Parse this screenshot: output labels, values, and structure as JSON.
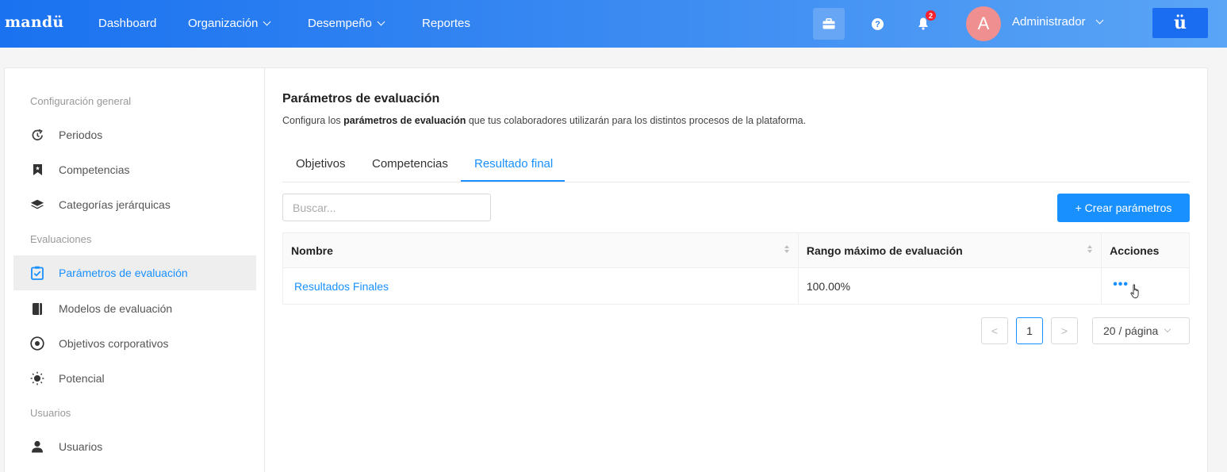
{
  "header": {
    "logo": "mandü",
    "nav": [
      {
        "label": "Dashboard",
        "dropdown": false
      },
      {
        "label": "Organización",
        "dropdown": true
      },
      {
        "label": "Desempeño",
        "dropdown": true
      },
      {
        "label": "Reportes",
        "dropdown": false
      }
    ],
    "help_glyph": "?",
    "notifications_count": "2",
    "avatar_initial": "A",
    "username": "Administrador",
    "brand_button": "ü",
    "colors": {
      "bar_start": "#1a72f0",
      "bar_end": "#5aa5f6",
      "avatar": "#ef8f8f"
    }
  },
  "sidebar": {
    "groups": [
      {
        "label": "Configuración general",
        "items": [
          {
            "label": "Periodos",
            "icon": "refresh-clock-icon"
          },
          {
            "label": "Competencias",
            "icon": "bookmark-icon"
          },
          {
            "label": "Categorías jerárquicas",
            "icon": "layers-icon"
          }
        ]
      },
      {
        "label": "Evaluaciones",
        "items": [
          {
            "label": "Parámetros de evaluación",
            "icon": "checklist-icon",
            "active": true
          },
          {
            "label": "Modelos de evaluación",
            "icon": "book-icon"
          },
          {
            "label": "Objetivos corporativos",
            "icon": "target-icon"
          },
          {
            "label": "Potencial",
            "icon": "bulb-icon"
          }
        ]
      },
      {
        "label": "Usuarios",
        "items": [
          {
            "label": "Usuarios",
            "icon": "user-icon"
          }
        ]
      }
    ]
  },
  "main": {
    "title": "Parámetros de evaluación",
    "desc_pre": "Configura los ",
    "desc_bold": "parámetros de evaluación",
    "desc_post": " que tus colaboradores utilizarán para los distintos procesos de la plataforma.",
    "tabs": [
      {
        "label": "Objetivos"
      },
      {
        "label": "Competencias"
      },
      {
        "label": "Resultado final",
        "active": true
      }
    ],
    "search_placeholder": "Buscar...",
    "create_button": "+ Crear parámetros",
    "table": {
      "headers": [
        "Nombre",
        "Rango máximo de evaluación",
        "Acciones"
      ],
      "rows": [
        {
          "name": "Resultados Finales",
          "range": "100.00%",
          "actions": "•••"
        }
      ]
    },
    "pagination": {
      "prev": "<",
      "current": "1",
      "next": ">",
      "page_size": "20 / página"
    },
    "accent_color": "#1890ff"
  }
}
